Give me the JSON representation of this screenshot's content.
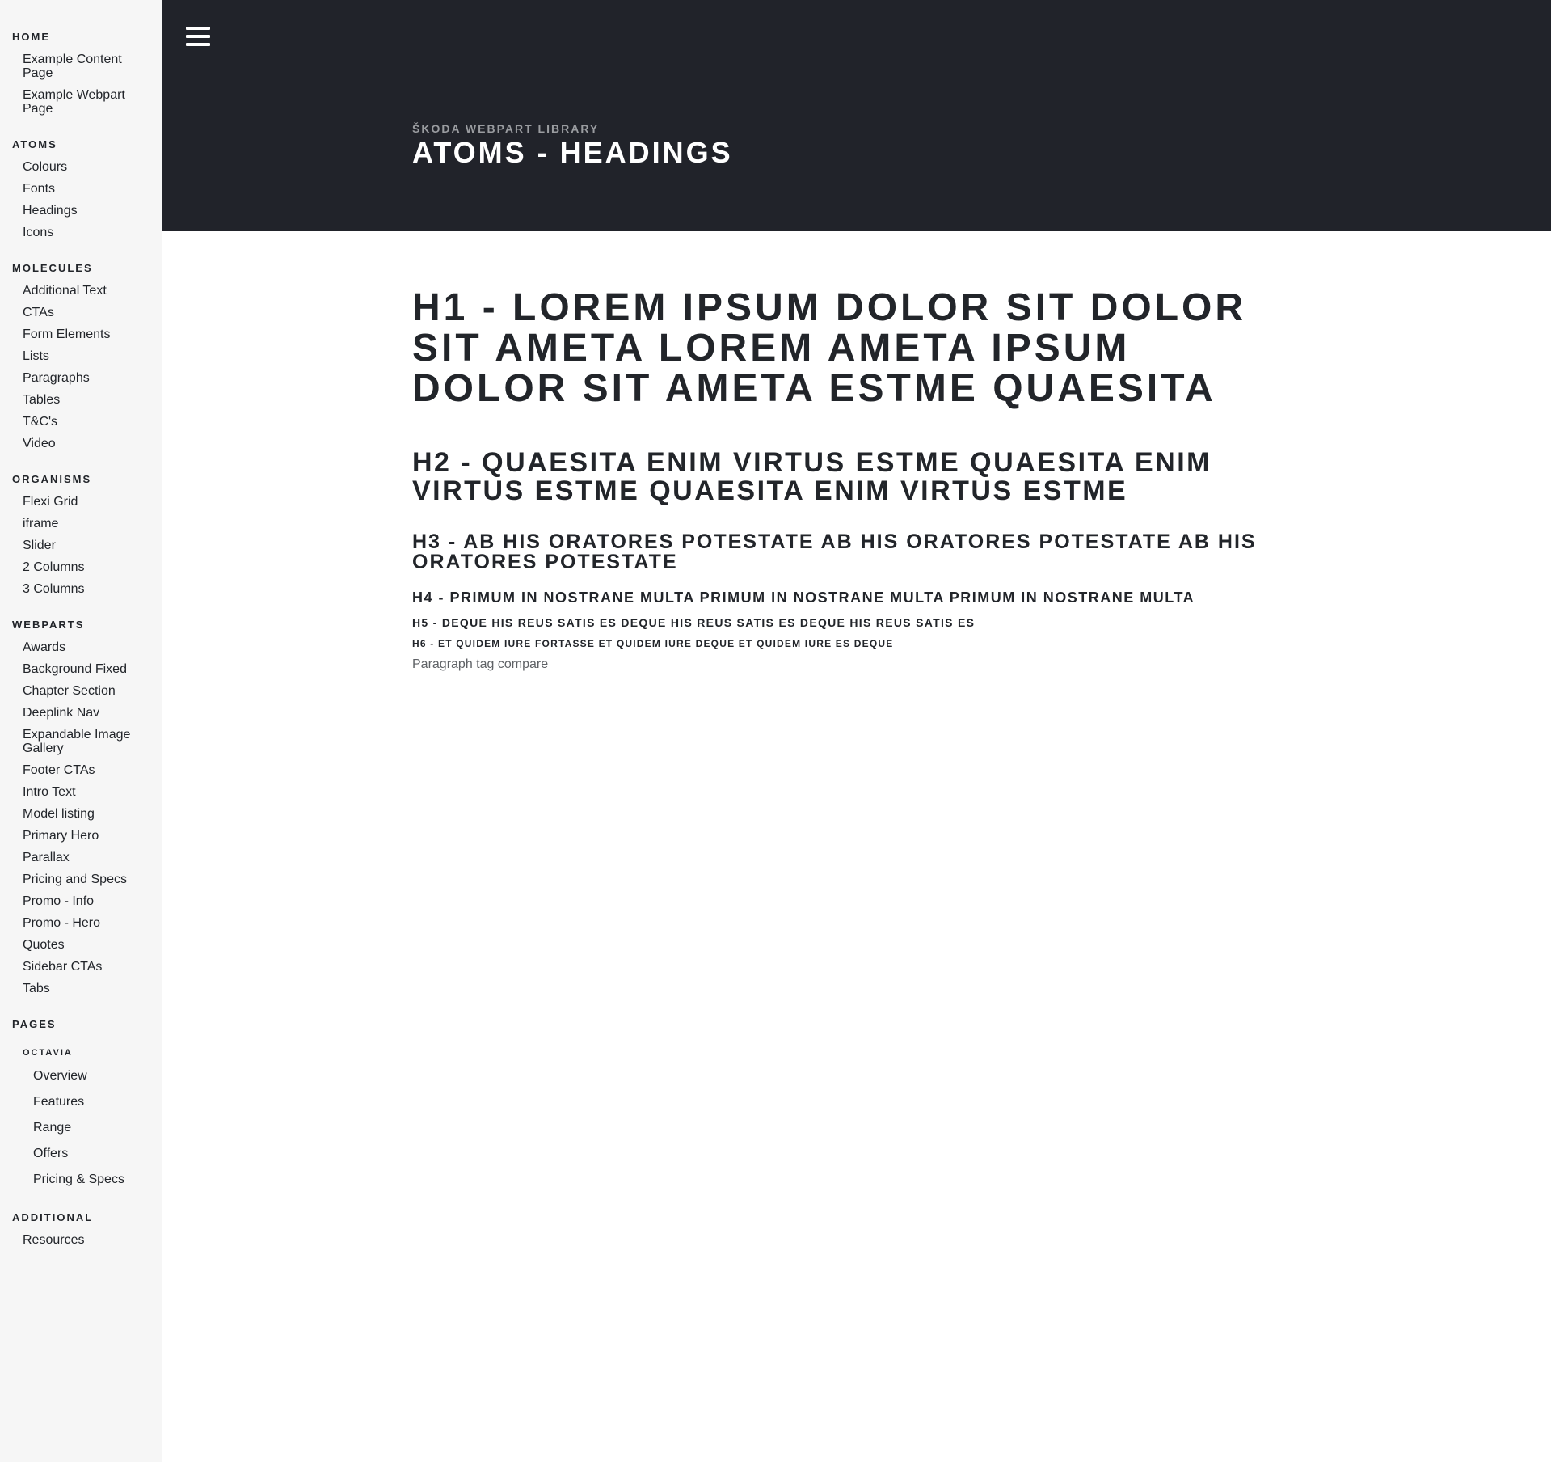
{
  "sidebar": {
    "groups": [
      {
        "heading": "Home",
        "items": [
          "Example Content Page",
          "Example Webpart Page"
        ]
      },
      {
        "heading": "Atoms",
        "items": [
          "Colours",
          "Fonts",
          "Headings",
          "Icons"
        ]
      },
      {
        "heading": "Molecules",
        "items": [
          "Additional Text",
          "CTAs",
          "Form Elements",
          "Lists",
          "Paragraphs",
          "Tables",
          "T&C's",
          "Video"
        ]
      },
      {
        "heading": "Organisms",
        "items": [
          "Flexi Grid",
          "iframe",
          "Slider",
          "2 Columns",
          "3 Columns"
        ]
      },
      {
        "heading": "Webparts",
        "items": [
          "Awards",
          "Background Fixed",
          "Chapter Section",
          "Deeplink Nav",
          "Expandable Image Gallery",
          "Footer CTAs",
          "Intro Text",
          "Model listing",
          "Primary Hero",
          "Parallax",
          "Pricing and Specs",
          "Promo - Info",
          "Promo - Hero",
          "Quotes",
          "Sidebar CTAs",
          "Tabs"
        ]
      },
      {
        "heading": "Pages",
        "items": [],
        "sub": {
          "heading": "Octavia",
          "items": [
            "Overview",
            "Features",
            "Range",
            "Offers",
            "Pricing & Specs"
          ]
        }
      },
      {
        "heading": "Additional",
        "items": [
          "Resources"
        ]
      }
    ]
  },
  "header": {
    "menu_icon": "hamburger-menu-icon",
    "eyebrow": "Škoda Webpart Library",
    "title": "Atoms - Headings",
    "background": "#21232a"
  },
  "content": {
    "h1": "H1 - Lorem ipsum dolor sit dolor sit ameta lorem ameta ipsum dolor sit ameta estme quaesita",
    "h2": "H2 - Quaesita enim virtus estme quaesita enim virtus estme quaesita enim virtus estme",
    "h3": "H3 - Ab his oratores potestate ab his oratores potestate ab his oratores potestate",
    "h4": "H4 - Primum in nostrane multa primum in nostrane multa primum in nostrane multa",
    "h5": "H5 - Deque his reus satis es deque his reus satis es deque his reus satis es",
    "h6": "H6 - et quidem iure fortasse et quidem iure deque et quidem iure es deque",
    "paragraph": "Paragraph tag compare"
  }
}
